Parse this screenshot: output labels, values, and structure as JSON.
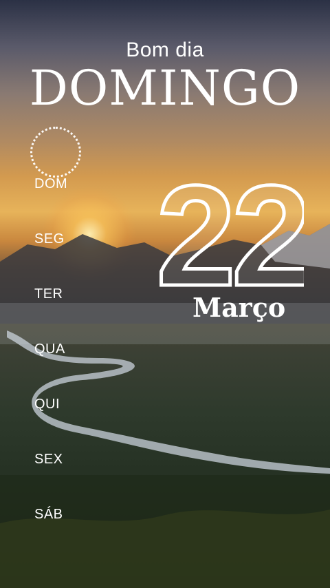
{
  "greeting": "Bom dia",
  "day_name": "DOMINGO",
  "date": {
    "day": "22",
    "month": "Março"
  },
  "weekdays": [
    "DOM",
    "SEG",
    "TER",
    "QUA",
    "QUI",
    "SEX",
    "SÁB"
  ],
  "selected_weekday": "DOM",
  "colors": {
    "text": "#ffffff",
    "sky_glow": "#e7b35a"
  }
}
